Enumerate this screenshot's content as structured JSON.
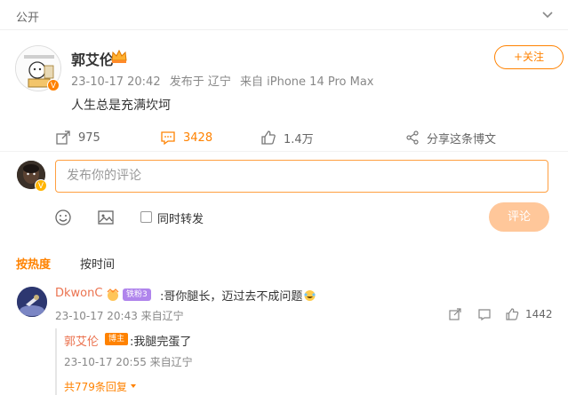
{
  "topbar": {
    "visibility": "公开",
    "chevron_icon": "chevron-down-icon"
  },
  "post": {
    "author": "郭艾伦",
    "verified_icon": "v-badge-icon",
    "crown_icon": "crown-icon",
    "time": "23-10-17 20:42",
    "location": "发布于 辽宁",
    "device": "来自 iPhone 14 Pro Max",
    "content": "人生总是充满坎坷",
    "follow_label": "+关注"
  },
  "actions": {
    "repost_count": "975",
    "comment_count": "3428",
    "like_count": "1.4万",
    "share_label": "分享这条博文"
  },
  "composer": {
    "placeholder": "发布你的评论",
    "repost_label": "同时转发",
    "send_label": "评论"
  },
  "tabs": {
    "hot": "按热度",
    "time": "按时间"
  },
  "comment": {
    "user": "DkwonC",
    "fan_badge": "铁粉3",
    "text": ":哥你腿长，迈过去不成问题",
    "time": "23-10-17 20:43 来自辽宁",
    "likes": "1442"
  },
  "reply": {
    "user": "郭艾伦",
    "badge": "博主",
    "text": ":我腿完蛋了",
    "time": "23-10-17 20:55 来自辽宁",
    "more": "共779条回复"
  },
  "colors": {
    "accent": "#ff8200",
    "username": "#eb7350",
    "send_button_disabled": "#ffc79a"
  }
}
